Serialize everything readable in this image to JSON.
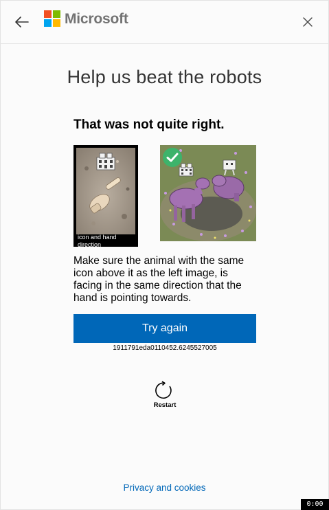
{
  "header": {
    "brand_name": "Microsoft",
    "back_icon": "arrow-left-icon",
    "close_icon": "close-icon",
    "logo_colors": [
      "#f25022",
      "#7fba00",
      "#00a4ef",
      "#ffb900"
    ]
  },
  "page": {
    "title": "Help us beat the robots"
  },
  "challenge": {
    "status_title": "That was not quite right.",
    "reference_caption": "icon and hand direction",
    "instructions": "Make sure the animal with the same icon above it as the left image, is facing in the same direction that the hand is pointing towards.",
    "try_again_label": "Try again",
    "session_id": "1911791eda0110452.6245527005",
    "selected_check_icon": "checkmark-icon"
  },
  "restart": {
    "label": "Restart",
    "icon": "refresh-icon"
  },
  "footer": {
    "privacy_link": "Privacy and cookies"
  },
  "timer": {
    "value": "0:00"
  },
  "colors": {
    "accent": "#0067b8",
    "success": "#3db36b"
  }
}
